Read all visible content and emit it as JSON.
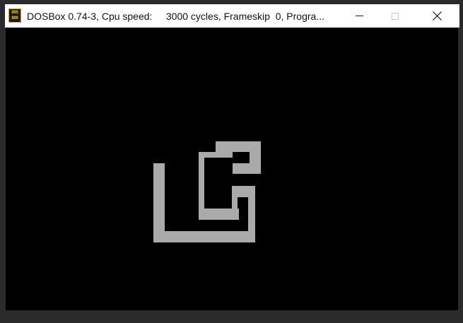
{
  "window": {
    "title": "DOSBox 0.74-3, Cpu speed:     3000 cycles, Frameskip  0, Progra...",
    "icon": {
      "name": "dosbox-icon",
      "line1": "DOS",
      "line2": "BOX"
    },
    "controls": {
      "minimize": "minimize-icon",
      "maximize": "maximize-icon",
      "close": "close-icon"
    }
  },
  "screen": {
    "background": "#000000",
    "drawing_color": "#aaaaaa",
    "cursor_color": "#aaaaaa"
  },
  "colors": {
    "titlebar_bg": "#ffffff",
    "frame": "#2b2b2b",
    "icon_accent": "#e8c23a"
  }
}
